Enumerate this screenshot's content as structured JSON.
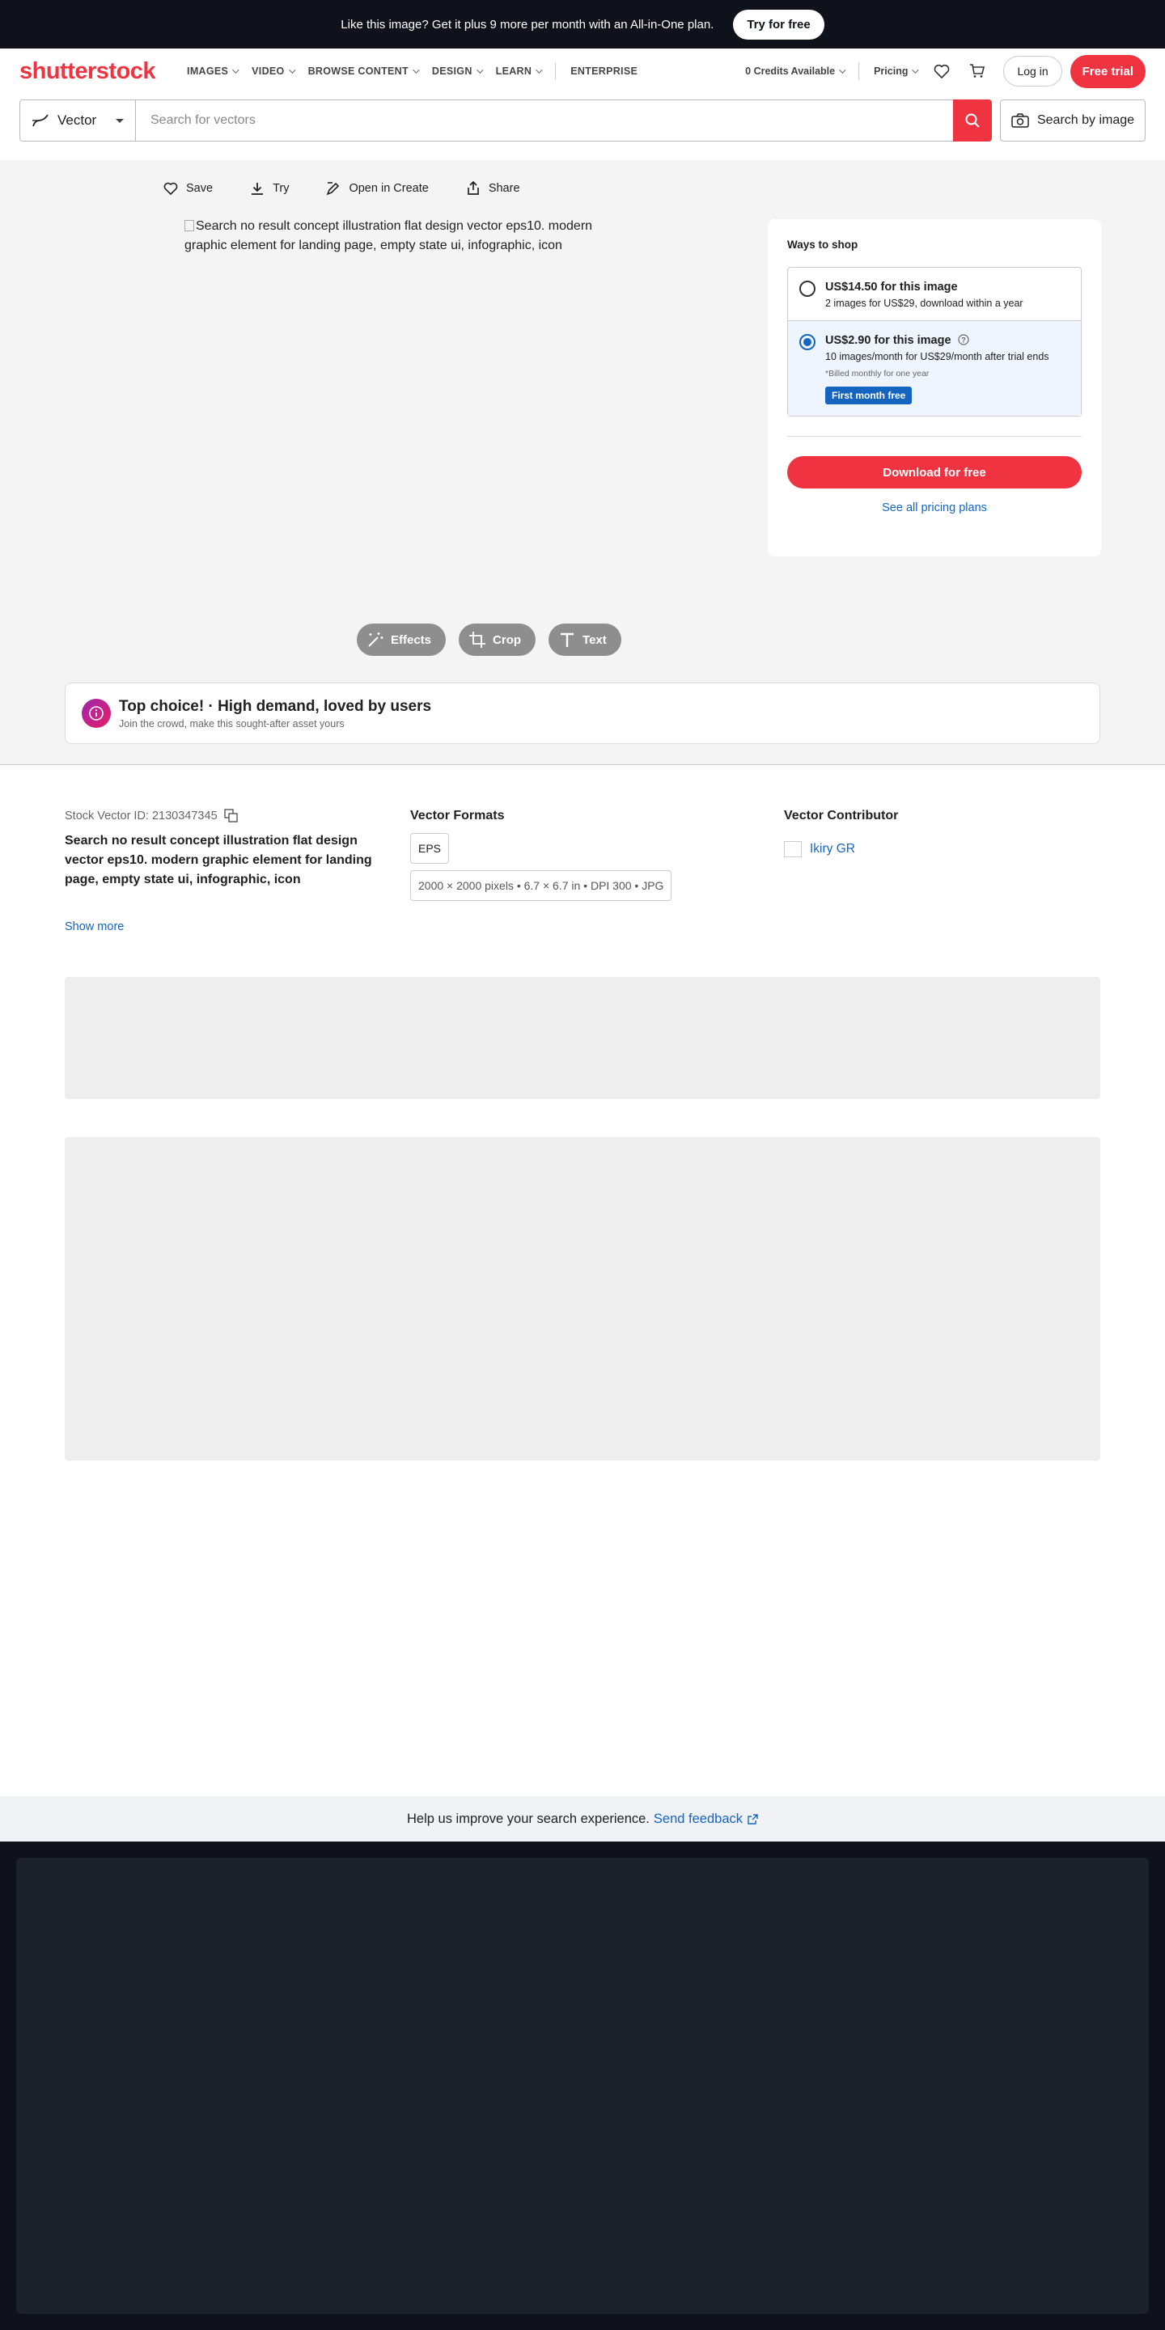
{
  "promo": {
    "text": "Like this image? Get it plus 9 more per month with an All-in-One plan.",
    "button": "Try for free"
  },
  "nav": {
    "logo": "shutterstock",
    "links": [
      "IMAGES",
      "VIDEO",
      "BROWSE CONTENT",
      "DESIGN",
      "LEARN"
    ],
    "enterprise": "ENTERPRISE",
    "credits": "0 Credits Available",
    "pricing": "Pricing",
    "login": "Log in",
    "trial": "Free trial"
  },
  "search": {
    "type": "Vector",
    "placeholder": "Search for vectors",
    "image_search": "Search by image"
  },
  "actions": [
    "Save",
    "Try",
    "Open in Create",
    "Share"
  ],
  "image_alt": "Search no result concept illustration flat design vector eps10. modern graphic element for landing page, empty state ui, infographic, icon",
  "shop": {
    "title": "Ways to shop",
    "option1": {
      "title": "US$14.50 for this image",
      "sub": "2 images for US$29, download within a year"
    },
    "option2": {
      "title": "US$2.90 for this image",
      "sub": "10 images/month for US$29/month after trial ends",
      "note": "*Billed monthly for one year",
      "badge": "First month free"
    },
    "download": "Download for free",
    "pricing_link": "See all pricing plans"
  },
  "tools": [
    "Effects",
    "Crop",
    "Text"
  ],
  "top_choice": {
    "title": "Top choice! · High demand, loved by users",
    "sub": "Join the crowd, make this sought-after asset yours"
  },
  "details": {
    "stock_id": "Stock Vector ID: 2130347345",
    "description": "Search no result concept illustration flat design vector eps10. modern graphic element for landing page, empty state ui, infographic, icon",
    "show_more": "Show more",
    "formats_head": "Vector Formats",
    "format": "EPS",
    "format_detail": "2000 × 2000 pixels • 6.7 × 6.7 in • DPI 300 • JPG",
    "contributor_head": "Vector Contributor",
    "contributor": "Ikiry GR"
  },
  "feedback": {
    "text": "Help us improve your search experience.",
    "link": "Send feedback"
  },
  "colors": {
    "brand": "#ef3340",
    "link": "#1565c0",
    "dark": "#0f121a"
  }
}
